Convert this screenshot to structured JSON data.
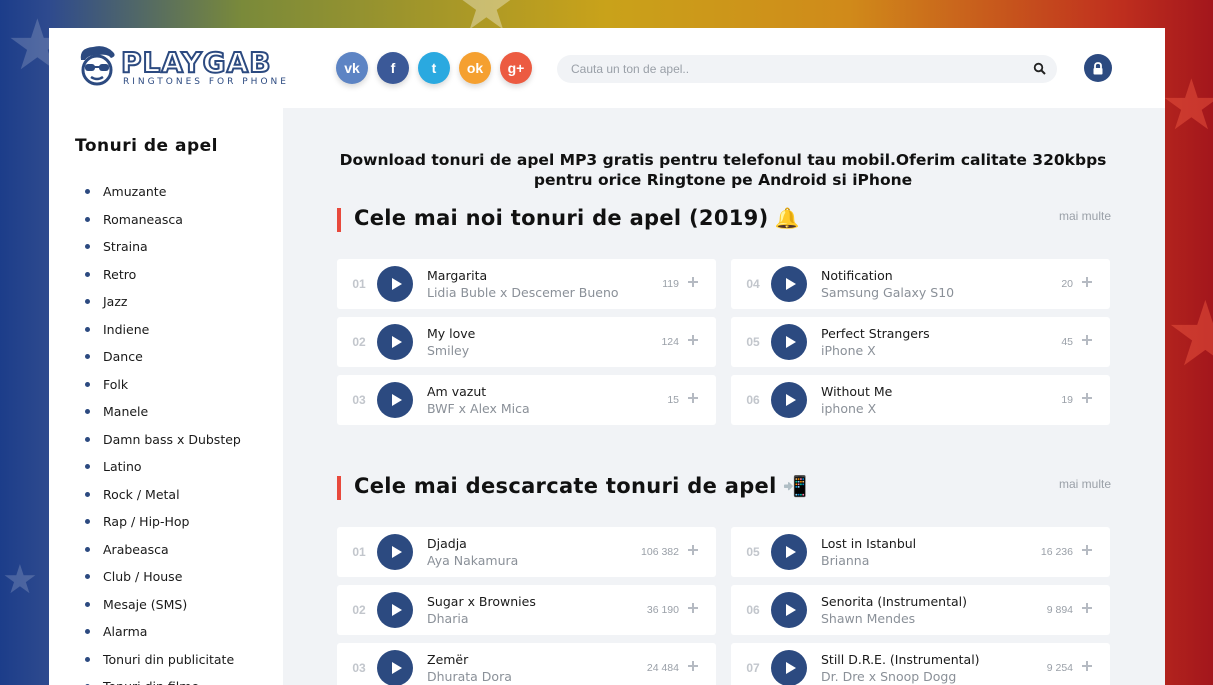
{
  "brand": {
    "name": "PLAYGAB",
    "tagline": "RINGTONES FOR PHONE"
  },
  "social": [
    {
      "label": "vk",
      "name": "vk-icon",
      "color": "#5d84c4"
    },
    {
      "label": "f",
      "name": "facebook-icon",
      "color": "#3b5998"
    },
    {
      "label": "t",
      "name": "twitter-icon",
      "color": "#2aa9e0"
    },
    {
      "label": "ok",
      "name": "odnoklassniki-icon",
      "color": "#f5a030"
    },
    {
      "label": "g+",
      "name": "google-plus-icon",
      "color": "#ec5b41"
    }
  ],
  "search": {
    "placeholder": "Cauta un ton de apel.."
  },
  "sidebar": {
    "title": "Tonuri de apel",
    "items": [
      "Amuzante",
      "Romaneasca",
      "Straina",
      "Retro",
      "Jazz",
      "Indiene",
      "Dance",
      "Folk",
      "Manele",
      "Damn bass x Dubstep",
      "Latino",
      "Rock / Metal",
      "Rap / Hip-Hop",
      "Arabeasca",
      "Club / House",
      "Mesaje (SMS)",
      "Alarma",
      "Tonuri din publicitate",
      "Tonuri din filme"
    ]
  },
  "main": {
    "intro": "Download tonuri de apel MP3 gratis pentru telefonul tau mobil.Oferim calitate 320kbps pentru orice Ringtone pe Android si iPhone",
    "sections": [
      {
        "title": "Cele mai noi tonuri de apel (2019)",
        "emoji": "🔔",
        "more": "mai multe",
        "tracks": [
          {
            "num": "01",
            "title": "Margarita",
            "artist": "Lidia Buble x Descemer Bueno",
            "count": "119"
          },
          {
            "num": "02",
            "title": "My love",
            "artist": "Smiley",
            "count": "124"
          },
          {
            "num": "03",
            "title": "Am vazut",
            "artist": "BWF x Alex Mica",
            "count": "15"
          },
          {
            "num": "04",
            "title": "Notification",
            "artist": "Samsung Galaxy S10",
            "count": "20"
          },
          {
            "num": "05",
            "title": "Perfect Strangers",
            "artist": "iPhone X",
            "count": "45"
          },
          {
            "num": "06",
            "title": "Without Me",
            "artist": "iphone X",
            "count": "19"
          }
        ]
      },
      {
        "title": "Cele mai descarcate tonuri de apel",
        "emoji": "📲",
        "more": "mai multe",
        "tracks": [
          {
            "num": "01",
            "title": "Djadja",
            "artist": "Aya Nakamura",
            "count": "106 382"
          },
          {
            "num": "02",
            "title": "Sugar x Brownies",
            "artist": "Dharia",
            "count": "36 190"
          },
          {
            "num": "03",
            "title": "Zemër",
            "artist": "Dhurata Dora",
            "count": "24 484"
          },
          {
            "num": "05",
            "title": "Lost in Istanbul",
            "artist": "Brianna",
            "count": "16 236"
          },
          {
            "num": "06",
            "title": "Senorita (Instrumental)",
            "artist": "Shawn Mendes",
            "count": "9 894"
          },
          {
            "num": "07",
            "title": "Still D.R.E. (Instrumental)",
            "artist": "Dr. Dre x Snoop Dogg",
            "count": "9 254"
          }
        ]
      }
    ]
  },
  "colors": {
    "accent": "#2c4a80",
    "section_bar": "#e8493c",
    "main_bg": "#f1f3f6"
  }
}
